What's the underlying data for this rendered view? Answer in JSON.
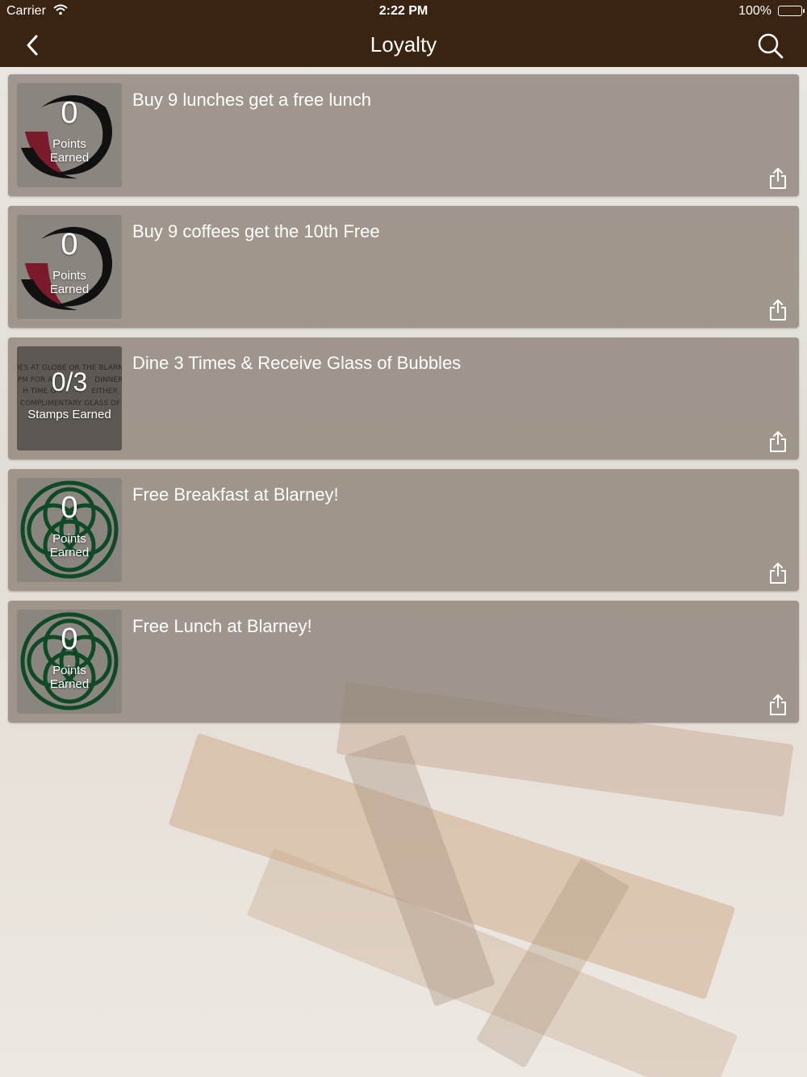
{
  "status_bar": {
    "carrier": "Carrier",
    "time": "2:22 PM",
    "battery": "100%"
  },
  "nav": {
    "title": "Loyalty",
    "back_icon": "chevron-left-icon",
    "search_icon": "search-icon"
  },
  "cards": [
    {
      "title": "Buy 9 lunches get a free lunch",
      "count": "0",
      "unit_line1": "Points",
      "unit_line2": "Earned",
      "logo": "red-swirl-logo"
    },
    {
      "title": "Buy 9 coffees get the 10th Free",
      "count": "0",
      "unit_line1": "Points",
      "unit_line2": "Earned",
      "logo": "red-swirl-logo"
    },
    {
      "title": "Dine 3 Times & Receive Glass of Bubbles",
      "count": "0/3",
      "unit_line1": "Stamps Earned",
      "printed_lines": [
        "IES AT GLOBE OR THE BLARN",
        "PM FOR A",
        "DINNER",
        "H TIME O",
        "EITHER",
        "COMPLIMENTARY GLASS OF"
      ],
      "logo": "printed-card-image"
    },
    {
      "title": "Free Breakfast at Blarney!",
      "count": "0",
      "unit_line1": "Points",
      "unit_line2": "Earned",
      "logo": "green-celtic-knot-logo"
    },
    {
      "title": "Free Lunch at Blarney!",
      "count": "0",
      "unit_line1": "Points",
      "unit_line2": "Earned",
      "logo": "green-celtic-knot-logo"
    }
  ],
  "colors": {
    "nav_background": "#3a2411",
    "card_background": "#8c8076",
    "swirl_red": "#7a1a2a",
    "knot_green": "#0e4a25"
  }
}
